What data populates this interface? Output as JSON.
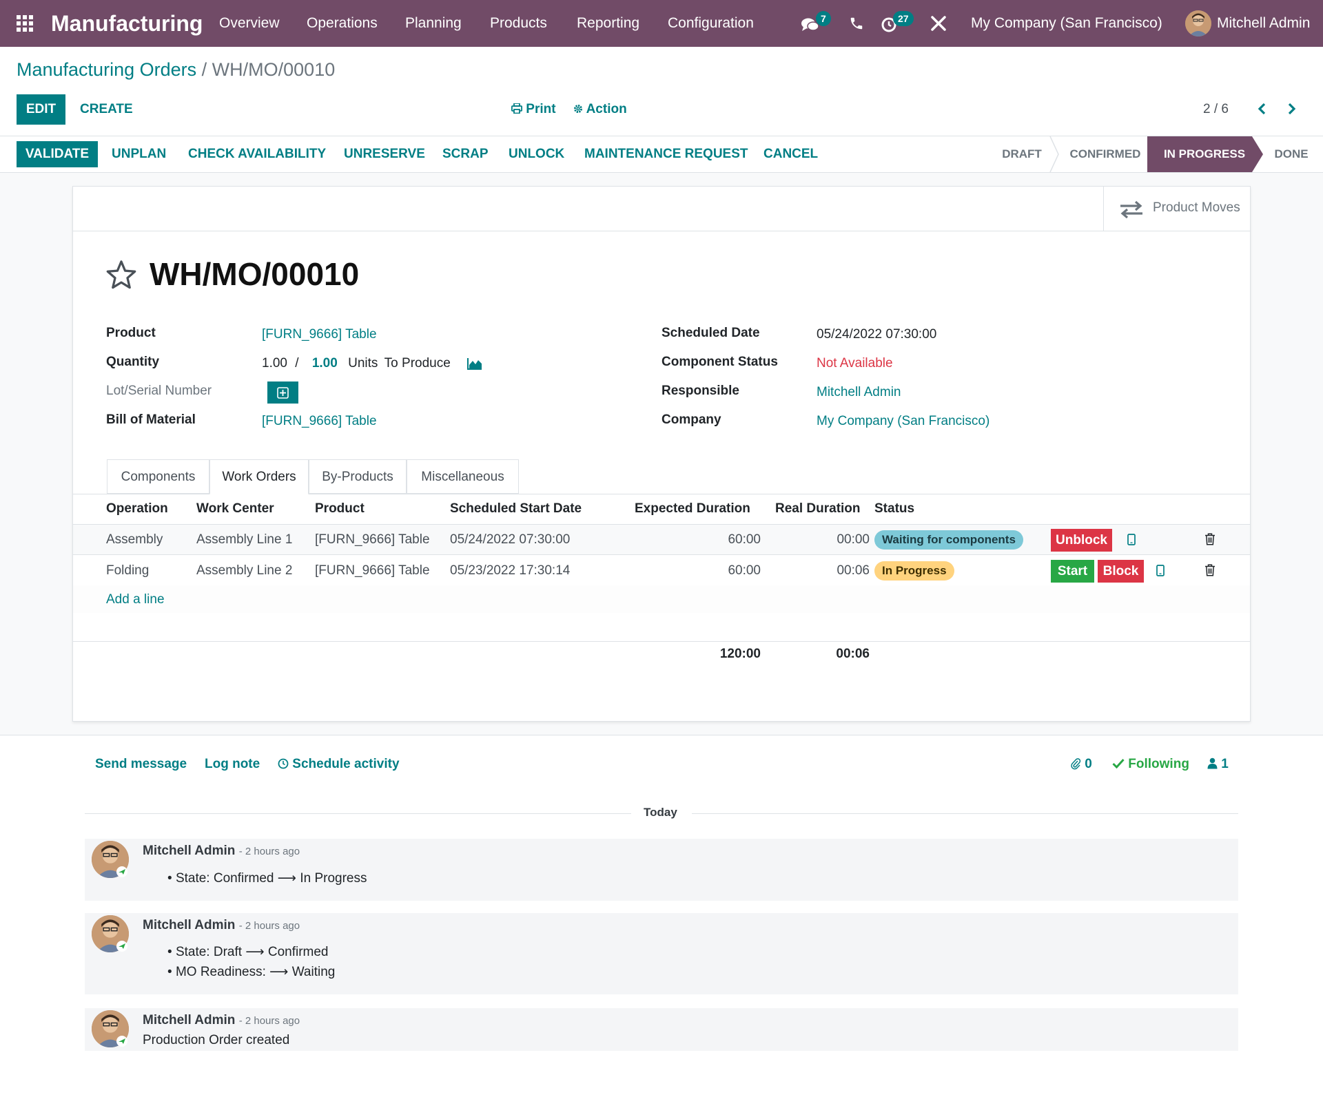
{
  "navbar": {
    "app_name": "Manufacturing",
    "menu": [
      "Overview",
      "Operations",
      "Planning",
      "Products",
      "Reporting",
      "Configuration"
    ],
    "messages_count": "7",
    "activities_count": "27",
    "company": "My Company (San Francisco)",
    "user": "Mitchell Admin"
  },
  "breadcrumb": {
    "parent": "Manufacturing Orders",
    "separator": "/",
    "current": "WH/MO/00010"
  },
  "control": {
    "edit": "EDIT",
    "create": "CREATE",
    "print": "Print",
    "action": "Action",
    "pager": "2 / 6"
  },
  "statusbar": {
    "buttons": [
      "VALIDATE",
      "UNPLAN",
      "CHECK AVAILABILITY",
      "UNRESERVE",
      "SCRAP",
      "UNLOCK",
      "MAINTENANCE REQUEST",
      "CANCEL"
    ],
    "stages": [
      "DRAFT",
      "CONFIRMED",
      "IN PROGRESS",
      "DONE"
    ],
    "active_stage": "IN PROGRESS"
  },
  "form": {
    "smart_button": "Product Moves",
    "title": "WH/MO/00010",
    "fields_left": {
      "product_label": "Product",
      "product_value": "[FURN_9666] Table",
      "quantity_label": "Quantity",
      "quantity_produced": "1.00",
      "quantity_sep": "/",
      "quantity_target": "1.00",
      "quantity_uom": "Units",
      "quantity_suffix": "To Produce",
      "lot_label": "Lot/Serial Number",
      "bom_label": "Bill of Material",
      "bom_value": "[FURN_9666] Table"
    },
    "fields_right": {
      "scheduled_label": "Scheduled Date",
      "scheduled_value": "05/24/2022 07:30:00",
      "component_label": "Component Status",
      "component_value": "Not Available",
      "responsible_label": "Responsible",
      "responsible_value": "Mitchell Admin",
      "company_label": "Company",
      "company_value": "My Company (San Francisco)"
    },
    "tabs": [
      "Components",
      "Work Orders",
      "By-Products",
      "Miscellaneous"
    ],
    "active_tab": "Work Orders"
  },
  "work_orders": {
    "columns": [
      "Operation",
      "Work Center",
      "Product",
      "Scheduled Start Date",
      "Expected Duration",
      "Real Duration",
      "Status"
    ],
    "rows": [
      {
        "operation": "Assembly",
        "work_center": "Assembly Line 1",
        "product": "[FURN_9666] Table",
        "start": "05/24/2022 07:30:00",
        "expected": "60:00",
        "real": "00:00",
        "status": "Waiting for components"
      },
      {
        "operation": "Folding",
        "work_center": "Assembly Line 2",
        "product": "[FURN_9666] Table",
        "start": "05/23/2022 17:30:14",
        "expected": "60:00",
        "real": "00:06",
        "status": "In Progress"
      }
    ],
    "btn_unblock": "Unblock",
    "btn_start": "Start",
    "btn_block": "Block",
    "add_line": "Add a line",
    "total_expected": "120:00",
    "total_real": "00:06"
  },
  "chatter": {
    "send_message": "Send message",
    "log_note": "Log note",
    "schedule_activity": "Schedule activity",
    "attachments": "0",
    "following": "Following",
    "followers": "1",
    "date_separator": "Today",
    "messages": [
      {
        "author": "Mitchell Admin",
        "ago": "- 2 hours ago",
        "lines": [
          {
            "from": "State: Confirmed",
            "to": "In Progress"
          }
        ]
      },
      {
        "author": "Mitchell Admin",
        "ago": "- 2 hours ago",
        "lines": [
          {
            "from": "State: Draft",
            "to": "Confirmed"
          },
          {
            "from": "MO Readiness:",
            "to": "Waiting"
          }
        ]
      },
      {
        "author": "Mitchell Admin",
        "ago": "- 2 hours ago",
        "body": "Production Order created"
      }
    ]
  },
  "colors": {
    "brand": "#714b67",
    "primary": "#017e84",
    "danger": "#dc3545",
    "success": "#28a745",
    "info_pill": "#7ec9d8",
    "warning_pill": "#ffd37e"
  }
}
